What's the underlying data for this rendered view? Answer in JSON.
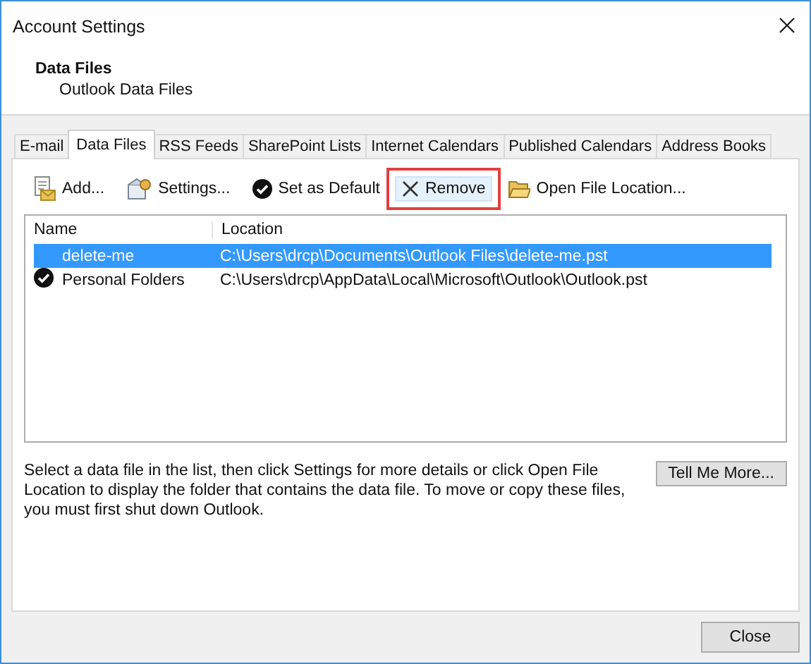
{
  "window": {
    "title": "Account Settings"
  },
  "header": {
    "title": "Data Files",
    "subtitle": "Outlook Data Files"
  },
  "tabs": [
    {
      "label": "E-mail",
      "selected": false
    },
    {
      "label": "Data Files",
      "selected": true
    },
    {
      "label": "RSS Feeds",
      "selected": false
    },
    {
      "label": "SharePoint Lists",
      "selected": false
    },
    {
      "label": "Internet Calendars",
      "selected": false
    },
    {
      "label": "Published Calendars",
      "selected": false
    },
    {
      "label": "Address Books",
      "selected": false
    }
  ],
  "toolbar": [
    {
      "kind": "add",
      "label": "Add...",
      "highlighted": false
    },
    {
      "kind": "settings",
      "label": "Settings...",
      "highlighted": false
    },
    {
      "kind": "default",
      "label": "Set as Default",
      "highlighted": false
    },
    {
      "kind": "remove",
      "label": "Remove",
      "highlighted": true
    },
    {
      "kind": "open",
      "label": "Open File Location...",
      "highlighted": false
    }
  ],
  "table": {
    "columns": [
      "Name",
      "Location"
    ],
    "rows": [
      {
        "name": "delete-me",
        "location": "C:\\Users\\drcp\\Documents\\Outlook Files\\delete-me.pst",
        "selected": true,
        "default": false
      },
      {
        "name": "Personal Folders",
        "location": "C:\\Users\\drcp\\AppData\\Local\\Microsoft\\Outlook\\Outlook.pst",
        "selected": false,
        "default": true
      }
    ]
  },
  "description": "Select a data file in the list, then click Settings for more details or click Open File Location to display the folder that contains the data file. To move or copy these files, you must first shut down Outlook.",
  "buttons": {
    "tell_me_more": "Tell Me More...",
    "close": "Close"
  }
}
